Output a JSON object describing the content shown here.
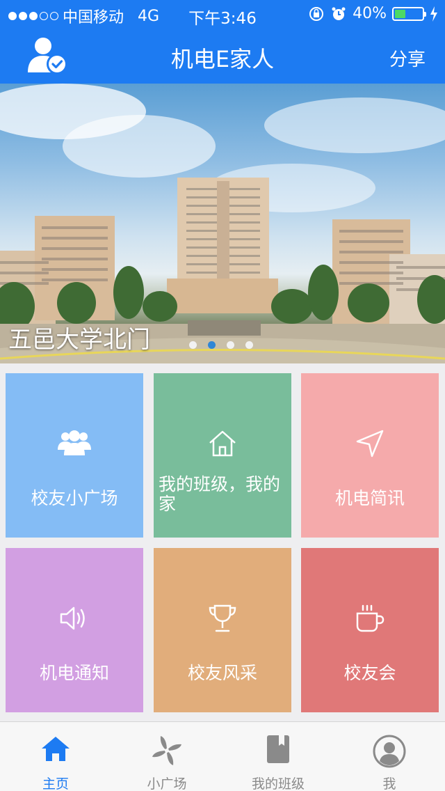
{
  "status_bar": {
    "carrier": "中国移动",
    "network": "4G",
    "time": "下午3:46",
    "battery": "40%",
    "battery_level": 0.4,
    "signal_bars": 3,
    "signal_total": 5
  },
  "nav": {
    "title": "机电E家人",
    "share_label": "分享"
  },
  "banner": {
    "caption": "五邑大学北门",
    "page_count": 4,
    "active_page": 1
  },
  "tiles": [
    {
      "label": "校友小广场",
      "icon": "people-icon",
      "color": "#84bcf5"
    },
    {
      "label": "我的班级，我的家",
      "icon": "home-icon",
      "color": "#79bd9b"
    },
    {
      "label": "机电简讯",
      "icon": "navigation-arrow-icon",
      "color": "#f5aaab"
    },
    {
      "label": "机电通知",
      "icon": "speaker-icon",
      "color": "#d29fe2"
    },
    {
      "label": "校友风采",
      "icon": "trophy-icon",
      "color": "#e1ad7b"
    },
    {
      "label": "校友会",
      "icon": "coffee-cup-icon",
      "color": "#e07878"
    }
  ],
  "tab_bar": {
    "tabs": [
      {
        "label": "主页",
        "icon": "home-icon",
        "active": true
      },
      {
        "label": "小广场",
        "icon": "pinwheel-icon",
        "active": false
      },
      {
        "label": "我的班级",
        "icon": "book-icon",
        "active": false
      },
      {
        "label": "我",
        "icon": "user-icon",
        "active": false
      }
    ]
  },
  "colors": {
    "primary": "#1d7bf2",
    "tab_inactive": "#8a8a8a"
  }
}
